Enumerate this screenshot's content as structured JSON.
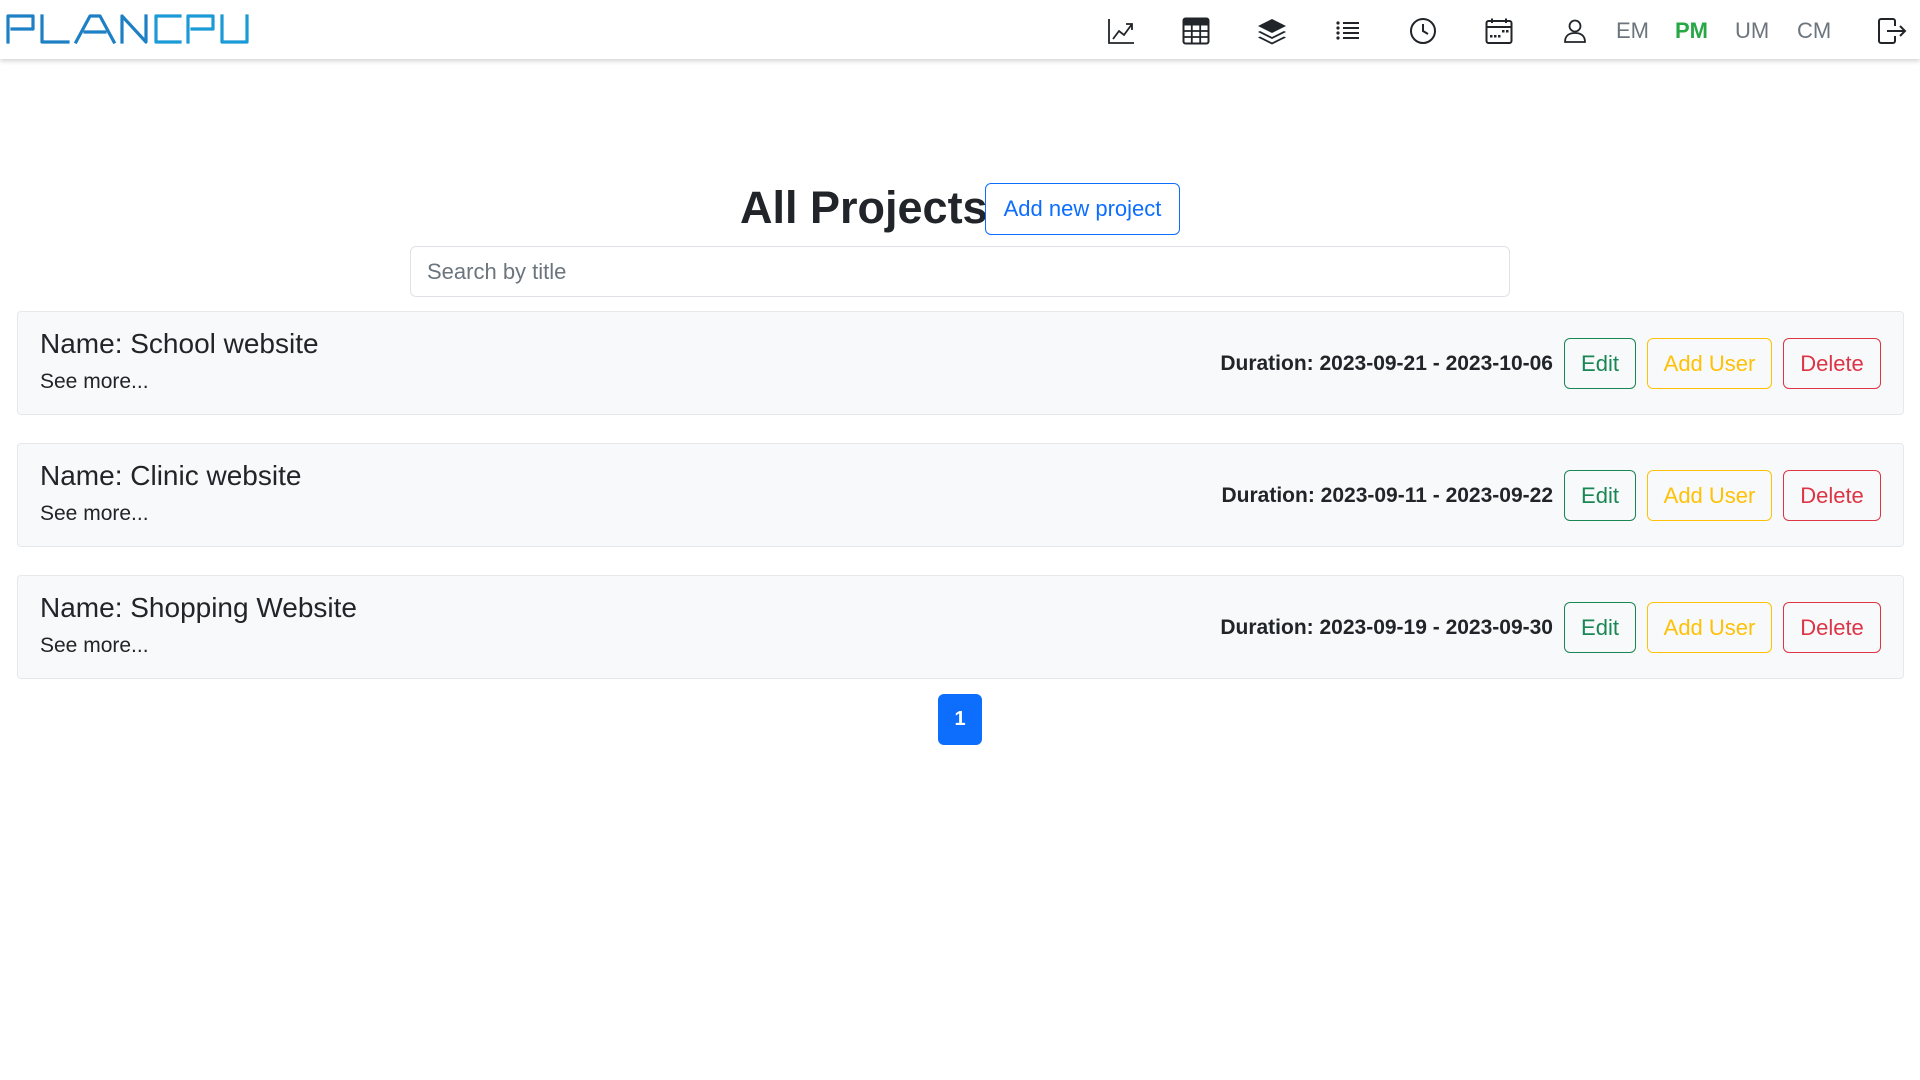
{
  "navbar": {
    "logo_text": "PLANCPU",
    "icons": [
      "chart-line-icon",
      "table-icon",
      "layers-icon",
      "list-icon",
      "clock-icon",
      "calendar-icon",
      "user-icon"
    ],
    "role_links": [
      "EM",
      "PM",
      "UM",
      "CM"
    ],
    "active_role": "PM",
    "active_color": "#28a745",
    "logout_icon": "logout-icon"
  },
  "header": {
    "title": "All Projects:",
    "add_button_label": "Add new project"
  },
  "search": {
    "placeholder": "Search by title",
    "value": ""
  },
  "projects": [
    {
      "name": "Name: School website",
      "see_more": "See more...",
      "duration": "Duration: 2023-09-21 - 2023-10-06",
      "edit_label": "Edit",
      "add_user_label": "Add User",
      "delete_label": "Delete"
    },
    {
      "name": "Name: Clinic website",
      "see_more": "See more...",
      "duration": "Duration: 2023-09-11 - 2023-09-22",
      "edit_label": "Edit",
      "add_user_label": "Add User",
      "delete_label": "Delete"
    },
    {
      "name": "Name: Shopping Website",
      "see_more": "See more...",
      "duration": "Duration: 2023-09-19 - 2023-09-30",
      "edit_label": "Edit",
      "add_user_label": "Add User",
      "delete_label": "Delete"
    }
  ],
  "pagination": {
    "current_page": "1"
  },
  "colors": {
    "primary": "#0d6efd",
    "success": "#198754",
    "warning": "#ffc107",
    "danger": "#dc3545",
    "logo": "#1d7fc4"
  }
}
